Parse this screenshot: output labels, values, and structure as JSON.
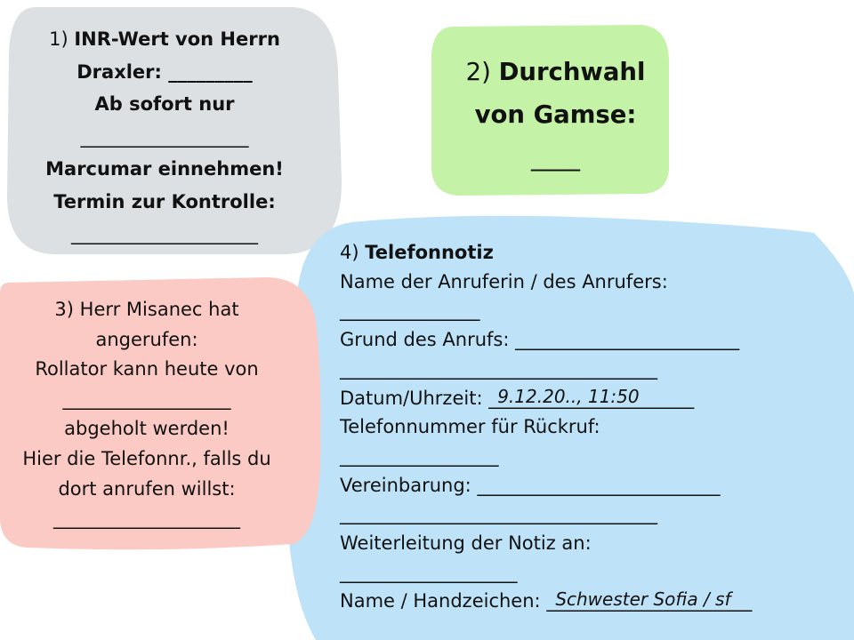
{
  "colors": {
    "box1_bg": "#dde0e3",
    "box2_bg": "#c4f2a6",
    "box3_bg": "#fbcac4",
    "box4_bg": "#bee3f8"
  },
  "box1": {
    "line1_num": "1)",
    "line1_bold": "INR-Wert von Herrn",
    "line2": "Draxler: _________",
    "line3": "Ab sofort nur",
    "line4": "__________________",
    "line5": "Marcumar einnehmen!",
    "line6": "Termin zur Kontrolle:",
    "line7": "____________________"
  },
  "box2": {
    "num": "2)",
    "line1_bold": "Durchwahl",
    "line2": "von Gamse:",
    "line3": "____"
  },
  "box3": {
    "line1": "3) Herr Misanec hat",
    "line2": "angerufen:",
    "line3": "Rollator kann heute von",
    "line4": "__________________",
    "line5": "abgeholt werden!",
    "line6": "Hier die Telefonnr., falls du",
    "line7": "dort anrufen willst:",
    "line8": "____________________"
  },
  "box4": {
    "num": "4)",
    "title": "Telefonnotiz",
    "caller_label": "Name der Anruferin / des Anrufers:",
    "caller_line": "_______________",
    "reason_label": "Grund des Anrufs:",
    "reason_line": "________________________",
    "reason_line2": "__________________________________",
    "datetime_label": "Datum/Uhrzeit:",
    "datetime_line": "______________________",
    "datetime_value": "9.12.20.., 11:50",
    "phone_label": "Telefonnummer für Rückruf:",
    "phone_line": "_________________",
    "agreement_label": "Vereinbarung:",
    "agreement_line": "__________________________",
    "agreement_line2": "__________________________________",
    "forward_label": "Weiterleitung der Notiz an:",
    "forward_line": "___________________",
    "signature_label": "Name / Handzeichen:",
    "signature_line": "______________________",
    "signature_value": "Schwester Sofia / sf"
  }
}
